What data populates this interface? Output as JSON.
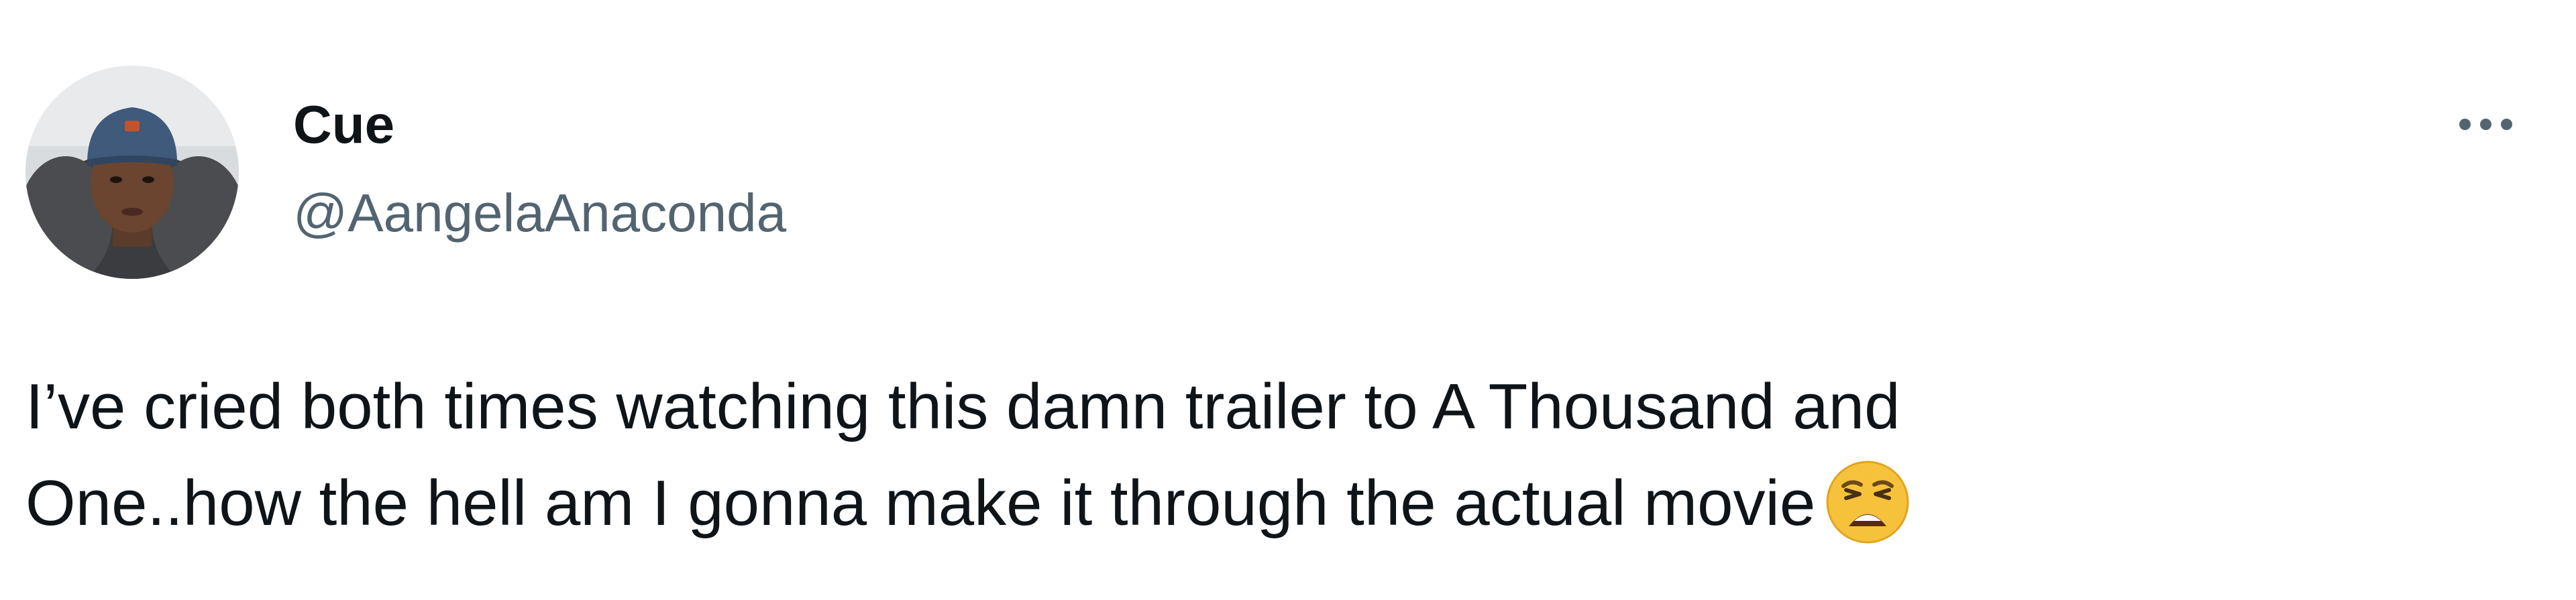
{
  "author": {
    "display_name": "Cue",
    "handle": "@AangelaAnaconda",
    "avatar_icon": "profile-photo"
  },
  "tweet": {
    "text_line_1": "I’ve cried both times watching this damn trailer to A Thousand and",
    "text_line_2": "One..how the hell am I gonna make it through the actual movie",
    "emoji": "weary-face-icon"
  },
  "menu": {
    "more_icon": "more-options-icon"
  },
  "colors": {
    "text_primary": "#0f1419",
    "text_secondary": "#536471",
    "background": "#ffffff",
    "emoji_yellow": "#f7c23b"
  }
}
